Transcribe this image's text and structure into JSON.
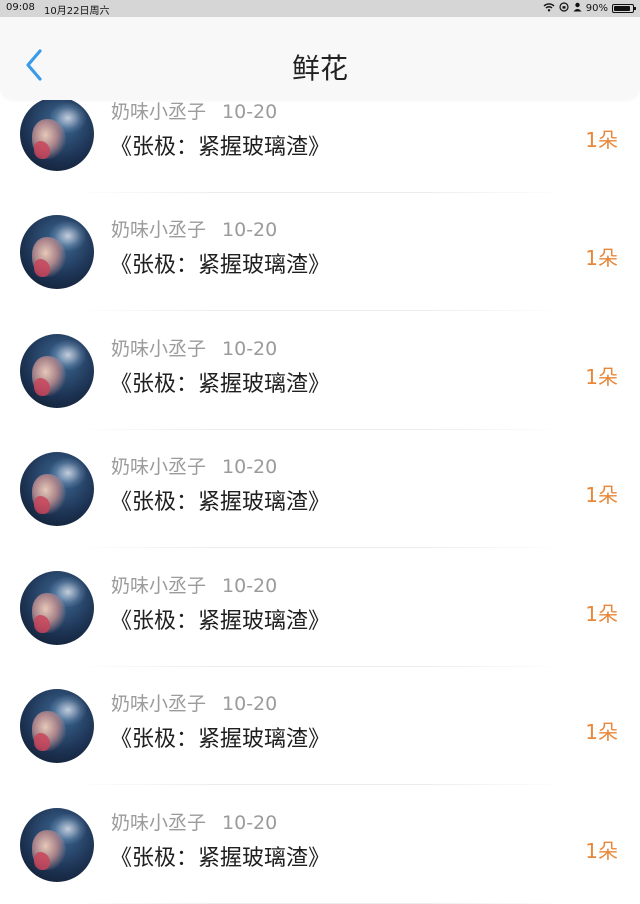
{
  "status_bar": {
    "time": "09:08",
    "date": "10月22日周六",
    "battery": "90%",
    "battery_level": 0.9
  },
  "nav": {
    "title": "鲜花",
    "accent_color": "#3a9be8"
  },
  "rows": [
    {
      "username": "奶味小丞子",
      "date": "10-20",
      "book": "《张极：紧握玻璃渣》",
      "count": "1朵"
    },
    {
      "username": "奶味小丞子",
      "date": "10-20",
      "book": "《张极：紧握玻璃渣》",
      "count": "1朵"
    },
    {
      "username": "奶味小丞子",
      "date": "10-20",
      "book": "《张极：紧握玻璃渣》",
      "count": "1朵"
    },
    {
      "username": "奶味小丞子",
      "date": "10-20",
      "book": "《张极：紧握玻璃渣》",
      "count": "1朵"
    },
    {
      "username": "奶味小丞子",
      "date": "10-20",
      "book": "《张极：紧握玻璃渣》",
      "count": "1朵"
    },
    {
      "username": "奶味小丞子",
      "date": "10-20",
      "book": "《张极：紧握玻璃渣》",
      "count": "1朵"
    },
    {
      "username": "奶味小丞子",
      "date": "10-20",
      "book": "《张极：紧握玻璃渣》",
      "count": "1朵"
    }
  ],
  "colors": {
    "count": "#e8873a",
    "username": "#9b9b9b"
  }
}
